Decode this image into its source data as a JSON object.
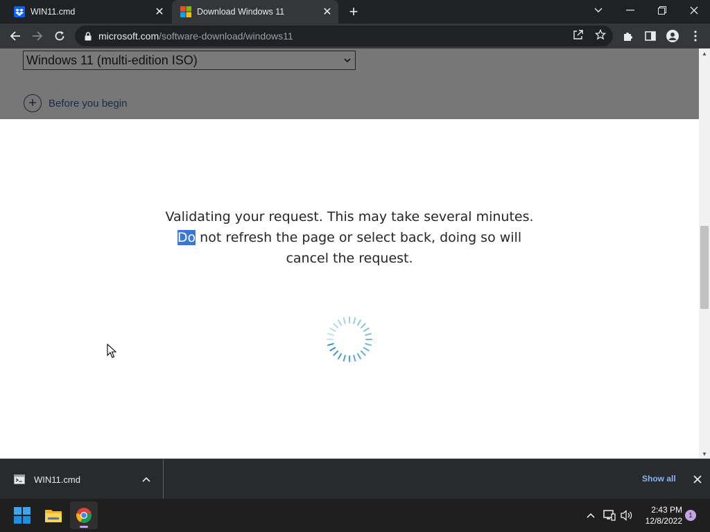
{
  "tabs": [
    {
      "title": "WIN11.cmd",
      "favicon": "dropbox-icon",
      "active": false
    },
    {
      "title": "Download Windows 11",
      "favicon": "microsoft-logo-icon",
      "active": true
    }
  ],
  "address_bar": {
    "domain": "microsoft.com",
    "path": "/software-download/windows11"
  },
  "page": {
    "edition_select_value": "Windows 11 (multi-edition ISO)",
    "before_label": "Before you begin",
    "message_highlight": "Do",
    "message_line1": "Validating your request. This may take several minutes.",
    "message_line2_rest": " not refresh the page or select back, doing so will",
    "message_line3": "cancel the request."
  },
  "download_bar": {
    "file_name": "WIN11.cmd",
    "show_all_label": "Show all"
  },
  "taskbar": {
    "time": "2:43 PM",
    "date": "12/8/2022",
    "notification_count": "1"
  },
  "colors": {
    "highlight": "#3b78d6",
    "show_all_link": "#8ab4f8",
    "spinner": "#2a8fbd"
  }
}
